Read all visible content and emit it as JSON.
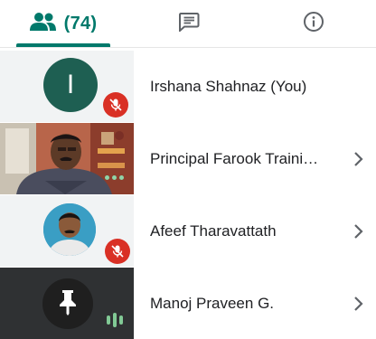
{
  "tabs": {
    "people": {
      "icon": "people-icon",
      "count_label": "(74)",
      "selected": true
    },
    "chat": {
      "icon": "chat-icon"
    },
    "info": {
      "icon": "info-icon"
    }
  },
  "colors": {
    "accent": "#00796b",
    "mute_badge": "#d93025",
    "text": "#202124"
  },
  "participants": [
    {
      "name": "Irshana Shahnaz (You)",
      "avatar_letter": "I",
      "avatar_color": "#1e5f52",
      "status": "muted",
      "has_details": false
    },
    {
      "name": "Principal Farook Traini…",
      "status": "video-on",
      "has_details": true
    },
    {
      "name": "Afeef Tharavattath",
      "status": "muted",
      "has_details": true
    },
    {
      "name": "Manoj Praveen G.",
      "status": "speaking",
      "has_details": true
    }
  ]
}
